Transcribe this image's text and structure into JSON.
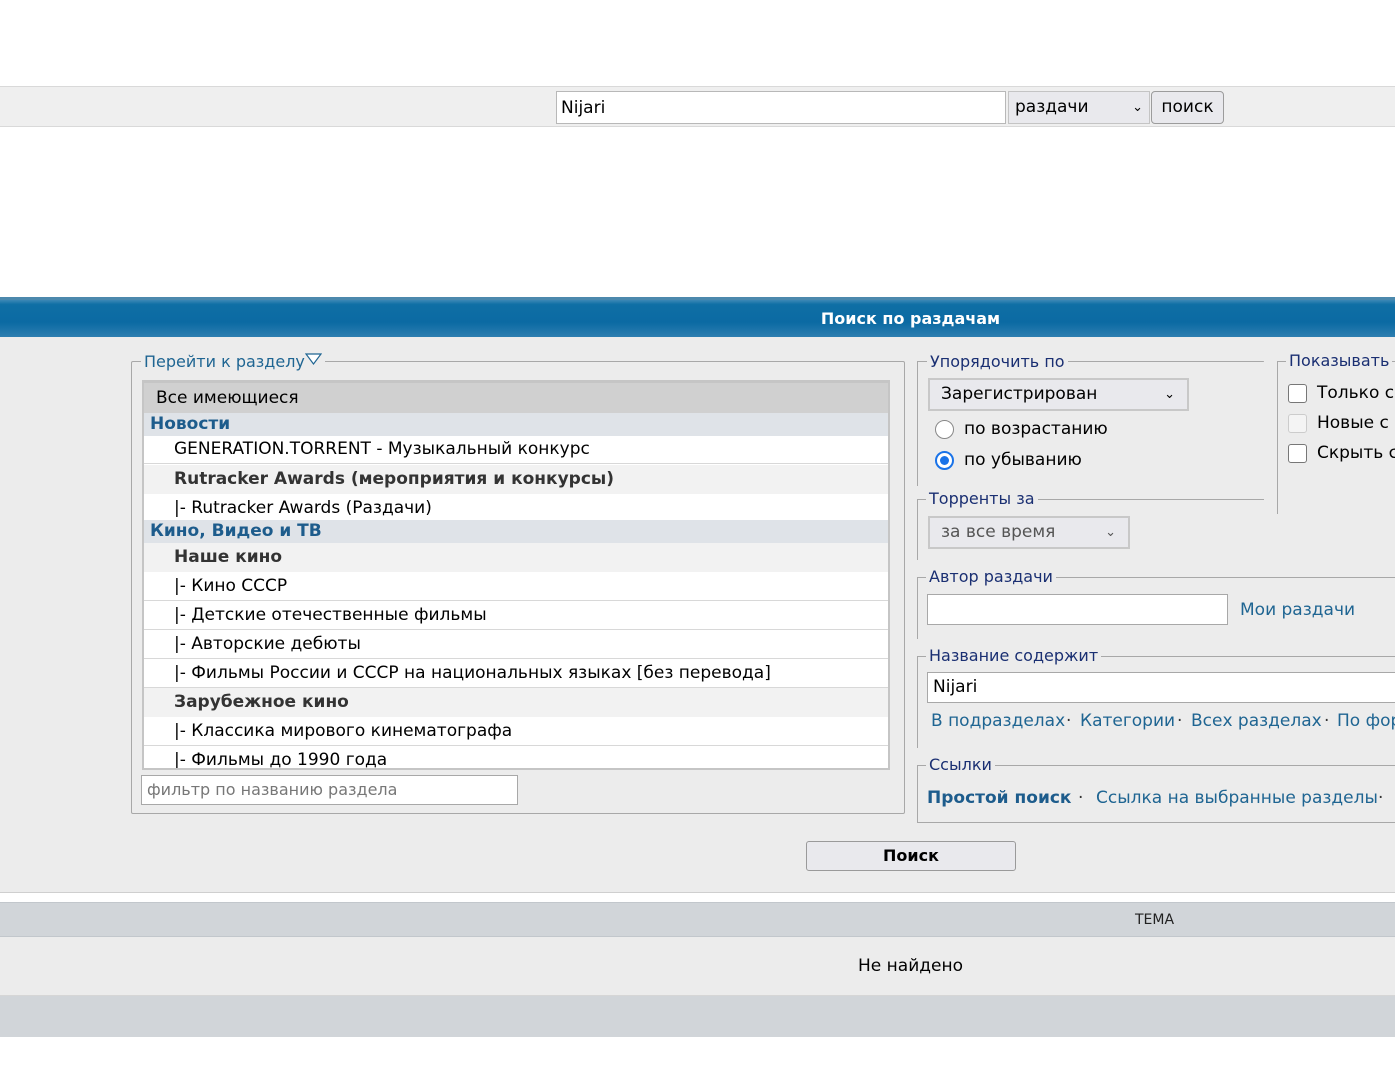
{
  "top_search": {
    "query": "Nijari",
    "scope": "раздачи",
    "button": "поиск"
  },
  "panel": {
    "title": "Поиск по раздачам"
  },
  "sections": {
    "legend": "Перейти к разделу",
    "options": [
      {
        "label": "Все имеющиеся",
        "kind": "all"
      },
      {
        "label": "Новости",
        "kind": "cat"
      },
      {
        "label": "GENERATION.TORRENT - Музыкальный конкурс",
        "kind": "sub"
      },
      {
        "label": "Rutracker Awards (мероприятия и конкурсы)",
        "kind": "grp"
      },
      {
        "label": "|- Rutracker Awards (Раздачи)",
        "kind": "sub"
      },
      {
        "label": "Кино, Видео и ТВ",
        "kind": "cat"
      },
      {
        "label": "Наше кино",
        "kind": "grp"
      },
      {
        "label": "|- Кино СССР",
        "kind": "sub"
      },
      {
        "label": "|- Детские отечественные фильмы",
        "kind": "sub"
      },
      {
        "label": "|- Авторские дебюты",
        "kind": "sub"
      },
      {
        "label": "|- Фильмы России и СССР на национальных языках [без перевода]",
        "kind": "sub"
      },
      {
        "label": "Зарубежное кино",
        "kind": "grp"
      },
      {
        "label": "|- Классика мирового кинематографа",
        "kind": "sub"
      },
      {
        "label": "|- Фильмы до 1990 года",
        "kind": "sub"
      }
    ],
    "filter_placeholder": "фильтр по названию раздела"
  },
  "order": {
    "legend": "Упорядочить по",
    "selected": "Зарегистрирован",
    "asc_label": "по возрастанию",
    "desc_label": "по убыванию",
    "direction": "desc"
  },
  "period": {
    "legend": "Торренты за",
    "selected": "за все время"
  },
  "show": {
    "legend": "Показывать",
    "options": [
      "Только с",
      "Новые с",
      "Скрыть с"
    ]
  },
  "author": {
    "legend": "Автор раздачи",
    "value": "",
    "my_link": "Мои раздачи"
  },
  "title_contains": {
    "legend": "Название содержит",
    "value": "Nijari",
    "links": [
      "В подразделах",
      "Категории",
      "Всех разделах",
      "По фор"
    ]
  },
  "links": {
    "legend": "Ссылки",
    "simple": "Простой поиск",
    "selected_sections": "Ссылка на выбранные разделы"
  },
  "submit": "Поиск",
  "results": {
    "header": "ТЕМА",
    "empty": "Не найдено"
  }
}
